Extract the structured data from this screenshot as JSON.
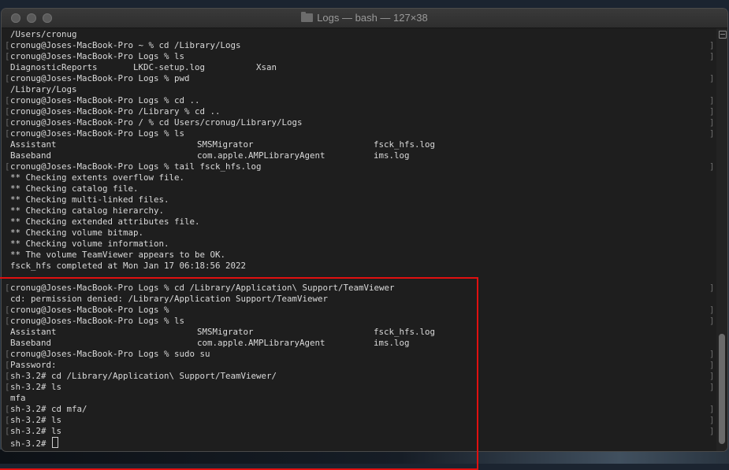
{
  "window": {
    "title": "Logs — bash — 127×38"
  },
  "terminal": {
    "lines": [
      {
        "text": "/Users/cronug",
        "left_bracket": "",
        "right_bracket": ""
      },
      {
        "text": "cronug@Joses-MacBook-Pro ~ % cd /Library/Logs",
        "left_bracket": "[",
        "right_bracket": "]"
      },
      {
        "text": "cronug@Joses-MacBook-Pro Logs % ls",
        "left_bracket": "[",
        "right_bracket": "]"
      },
      {
        "text": "DiagnosticReports       LKDC-setup.log          Xsan",
        "left_bracket": "",
        "right_bracket": ""
      },
      {
        "text": "cronug@Joses-MacBook-Pro Logs % pwd",
        "left_bracket": "[",
        "right_bracket": "]"
      },
      {
        "text": "/Library/Logs",
        "left_bracket": "",
        "right_bracket": ""
      },
      {
        "text": "cronug@Joses-MacBook-Pro Logs % cd ..",
        "left_bracket": "[",
        "right_bracket": "]"
      },
      {
        "text": "cronug@Joses-MacBook-Pro /Library % cd ..",
        "left_bracket": "[",
        "right_bracket": "]"
      },
      {
        "text": "cronug@Joses-MacBook-Pro / % cd Users/cronug/Library/Logs",
        "left_bracket": "[",
        "right_bracket": "]"
      },
      {
        "text": "cronug@Joses-MacBook-Pro Logs % ls",
        "left_bracket": "[",
        "right_bracket": "]"
      },
      {
        "cols": [
          "Assistant",
          "SMSMigrator",
          "fsck_hfs.log"
        ],
        "left_bracket": "",
        "right_bracket": ""
      },
      {
        "cols": [
          "Baseband",
          "com.apple.AMPLibraryAgent",
          "ims.log"
        ],
        "left_bracket": "",
        "right_bracket": ""
      },
      {
        "text": "cronug@Joses-MacBook-Pro Logs % tail fsck_hfs.log",
        "left_bracket": "[",
        "right_bracket": "]"
      },
      {
        "text": "** Checking extents overflow file.",
        "left_bracket": "",
        "right_bracket": ""
      },
      {
        "text": "** Checking catalog file.",
        "left_bracket": "",
        "right_bracket": ""
      },
      {
        "text": "** Checking multi-linked files.",
        "left_bracket": "",
        "right_bracket": ""
      },
      {
        "text": "** Checking catalog hierarchy.",
        "left_bracket": "",
        "right_bracket": ""
      },
      {
        "text": "** Checking extended attributes file.",
        "left_bracket": "",
        "right_bracket": ""
      },
      {
        "text": "** Checking volume bitmap.",
        "left_bracket": "",
        "right_bracket": ""
      },
      {
        "text": "** Checking volume information.",
        "left_bracket": "",
        "right_bracket": ""
      },
      {
        "text": "** The volume TeamViewer appears to be OK.",
        "left_bracket": "",
        "right_bracket": ""
      },
      {
        "text": "fsck_hfs completed at Mon Jan 17 06:18:56 2022",
        "left_bracket": "",
        "right_bracket": ""
      },
      {
        "text": "",
        "left_bracket": "",
        "right_bracket": ""
      },
      {
        "text": "cronug@Joses-MacBook-Pro Logs % cd /Library/Application\\ Support/TeamViewer",
        "left_bracket": "[",
        "right_bracket": "]"
      },
      {
        "text": "cd: permission denied: /Library/Application Support/TeamViewer",
        "left_bracket": "",
        "right_bracket": ""
      },
      {
        "text": "cronug@Joses-MacBook-Pro Logs %",
        "left_bracket": "[",
        "right_bracket": "]"
      },
      {
        "text": "cronug@Joses-MacBook-Pro Logs % ls",
        "left_bracket": "[",
        "right_bracket": "]"
      },
      {
        "cols": [
          "Assistant",
          "SMSMigrator",
          "fsck_hfs.log"
        ],
        "left_bracket": "",
        "right_bracket": ""
      },
      {
        "cols": [
          "Baseband",
          "com.apple.AMPLibraryAgent",
          "ims.log"
        ],
        "left_bracket": "",
        "right_bracket": ""
      },
      {
        "text": "cronug@Joses-MacBook-Pro Logs % sudo su",
        "left_bracket": "[",
        "right_bracket": "]"
      },
      {
        "text": "Password:",
        "left_bracket": "[",
        "right_bracket": "]"
      },
      {
        "text": "sh-3.2# cd /Library/Application\\ Support/TeamViewer/",
        "left_bracket": "[",
        "right_bracket": "]"
      },
      {
        "text": "sh-3.2# ls",
        "left_bracket": "[",
        "right_bracket": "]"
      },
      {
        "text": "mfa",
        "left_bracket": "",
        "right_bracket": ""
      },
      {
        "text": "sh-3.2# cd mfa/",
        "left_bracket": "[",
        "right_bracket": "]"
      },
      {
        "text": "sh-3.2# ls",
        "left_bracket": "[",
        "right_bracket": "]"
      },
      {
        "text": "sh-3.2# ls",
        "left_bracket": "[",
        "right_bracket": "]"
      },
      {
        "text": "sh-3.2# ",
        "left_bracket": "",
        "right_bracket": "",
        "cursor": true
      }
    ]
  },
  "colors": {
    "highlight_box": "#e01010",
    "terminal_bg": "#1e1e1e",
    "terminal_fg": "#d9d9d9"
  }
}
